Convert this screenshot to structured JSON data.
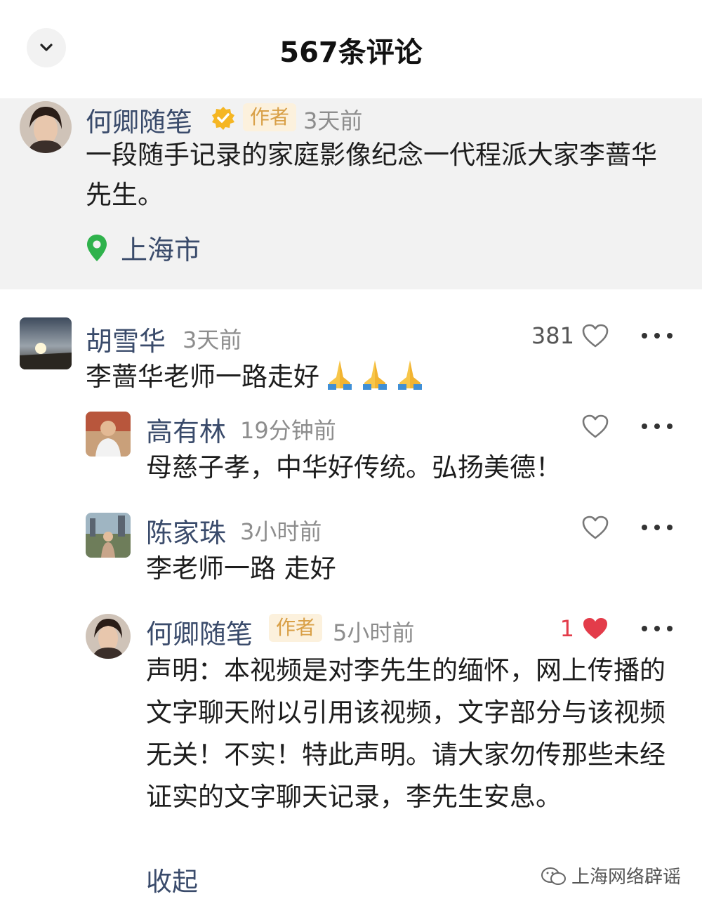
{
  "header": {
    "title": "567条评论",
    "back_icon": "chevron-down-icon"
  },
  "pinned": {
    "author": "何卿随笔",
    "verified_icon": "verified-badge-icon",
    "tag": "作者",
    "time": "3天前",
    "text": "一段随手记录的家庭影像纪念一代程派大家李蔷华先生。",
    "location": "上海市",
    "location_icon": "location-pin-icon"
  },
  "comments": [
    {
      "author": "胡雪华",
      "time": "3天前",
      "likes": "381",
      "text": "李蔷华老师一路走好",
      "emoji": "🙏🙏🙏",
      "replies": [
        {
          "author": "高有林",
          "time": "19分钟前",
          "likes": "",
          "text": "母慈子孝，中华好传统。弘扬美德！"
        },
        {
          "author": "陈家珠",
          "time": "3小时前",
          "likes": "",
          "text": "李老师一路 走好"
        },
        {
          "author": "何卿随笔",
          "tag": "作者",
          "time": "5小时前",
          "likes": "1",
          "liked": true,
          "text": "声明：本视频是对李先生的缅怀，网上传播的文字聊天附以引用该视频，文字部分与该视频无关！不实！特此声明。请大家勿传那些未经证实的文字聊天记录，李先生安息。"
        }
      ]
    }
  ],
  "collapse_label": "收起",
  "watermark": "上海网络辟谣",
  "colors": {
    "name": "#3a4b6b",
    "like_red": "#e33c4a",
    "tag_text": "#d9a047",
    "tag_bg": "#fcf1dd",
    "pinned_bg": "#f2f2f2"
  }
}
